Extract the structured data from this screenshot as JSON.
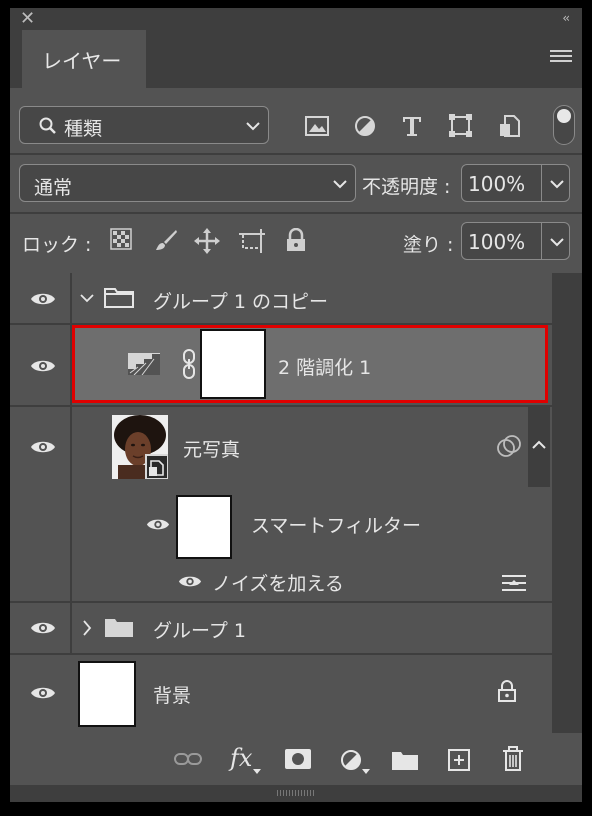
{
  "panel": {
    "tab_label": "レイヤー"
  },
  "filter": {
    "label": "種類"
  },
  "blend": {
    "mode": "通常",
    "opacity_label": "不透明度 :",
    "opacity_value": "100%"
  },
  "lock": {
    "label": "ロック :",
    "fill_label": "塗り :",
    "fill_value": "100%"
  },
  "layers": [
    {
      "name": "グループ 1 のコピー",
      "type": "group",
      "expanded": true
    },
    {
      "name": "2 階調化 1",
      "type": "adjustment",
      "selected": true
    },
    {
      "name": "元写真",
      "type": "smart-object"
    },
    {
      "name": "スマートフィルター",
      "type": "smart-filter"
    },
    {
      "name": "ノイズを加える",
      "type": "filter"
    },
    {
      "name": "グループ 1",
      "type": "group",
      "expanded": false
    },
    {
      "name": "背景",
      "type": "background",
      "locked": true
    }
  ],
  "footer": {
    "fx_label": "fx"
  },
  "colors": {
    "panel": "#535353",
    "dark": "#3e3e3e",
    "highlight": "#e00000",
    "selected": "#6e6e6e"
  }
}
